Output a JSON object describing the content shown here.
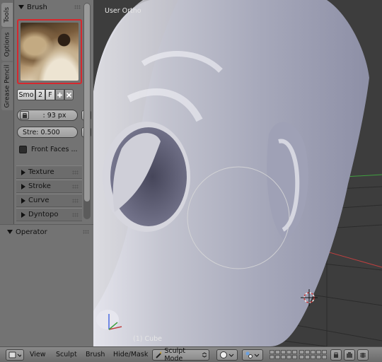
{
  "tabs": {
    "tools": "Tools",
    "options": "Options",
    "grease_pencil": "Grease Pencil"
  },
  "toolshelf": {
    "brush_panel": {
      "title": "Brush",
      "brush_name": "Smo",
      "users_count": "2",
      "fake_user": "F",
      "add_icon": "plus-icon",
      "remove_icon": "x-icon",
      "radius": ": 93 px",
      "strength": "Stre: 0.500",
      "front_faces_label": "Front Faces ...",
      "front_faces_checked": false
    },
    "subpanels": [
      "Texture",
      "Stroke",
      "Curve",
      "Dyntopo"
    ]
  },
  "operator": {
    "title": "Operator"
  },
  "viewport": {
    "view_label": "User Ortho",
    "object_label": "(1) Cube",
    "brush_cursor_radius": 93,
    "colors": {
      "background": "#3d3d3d",
      "mesh": "#b9bbc9",
      "x_axis": "#c04040",
      "y_axis": "#40a040"
    }
  },
  "header": {
    "menus": [
      "View",
      "Sculpt",
      "Brush",
      "Hide/Mask"
    ],
    "mode": "Sculpt Mode"
  }
}
